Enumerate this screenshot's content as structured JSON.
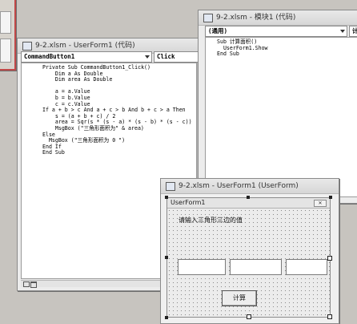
{
  "topleft_window": {},
  "userform_code_window": {
    "title": "9-2.xlsm - UserForm1 (代码)",
    "object_combo": "CommandButton1",
    "proc_combo": "Click",
    "code_lines": [
      "Private Sub CommandButton1_Click()",
      "    Dim a As Double",
      "    Dim area As Double",
      "",
      "    a = a.Value",
      "    b = b.Value",
      "    c = c.Value",
      "If a + b > c And a + c > b And b + c > a Then",
      "    s = (a + b + c) / 2",
      "    area = Sqr(s * (s - a) * (s - b) * (s - c))",
      "    MsgBox (\"三角形面积为\" & area)",
      "Else",
      "  MsgBox (\"三角形面积为 0 \")",
      "End If",
      "End Sub"
    ]
  },
  "module_window": {
    "title": "9-2.xlsm - 模块1 (代码)",
    "object_combo": "(通用)",
    "proc_combo": "计",
    "code_lines": [
      "Sub 计算面积()",
      "  UserForm1.Show",
      "End Sub"
    ]
  },
  "userform_designer": {
    "title": "9-2.xlsm - UserForm1 (UserForm)",
    "form_caption": "UserForm1",
    "label_text": "请输入三角形三边的值",
    "button_label": "计算"
  }
}
